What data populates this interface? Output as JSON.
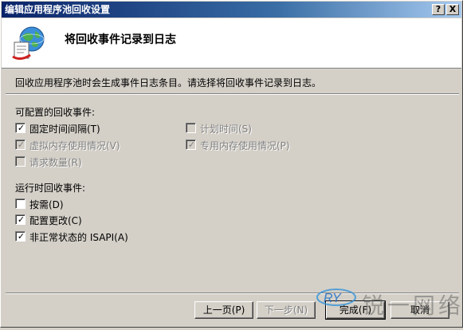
{
  "window": {
    "title": "编辑应用程序池回收设置",
    "help_button": "?",
    "close_button": "X"
  },
  "header": {
    "heading": "将回收事件记录到日志"
  },
  "description": "回收应用程序池时会生成事件日志条目。请选择将回收事件记录到日志。",
  "configurable": {
    "label": "可配置的回收事件:",
    "items": [
      {
        "label": "固定时间间隔(T)",
        "checked": true,
        "enabled": true
      },
      {
        "label": "计划时间(S)",
        "checked": false,
        "enabled": false
      },
      {
        "label": "虚拟内存使用情况(V)",
        "checked": true,
        "enabled": false
      },
      {
        "label": "专用内存使用情况(P)",
        "checked": true,
        "enabled": false
      },
      {
        "label": "请求数量(R)",
        "checked": false,
        "enabled": false
      }
    ]
  },
  "runtime": {
    "label": "运行时回收事件:",
    "items": [
      {
        "label": "按需(D)",
        "checked": false,
        "enabled": true
      },
      {
        "label": "配置更改(C)",
        "checked": true,
        "enabled": true
      },
      {
        "label": "非正常状态的 ISAPI(A)",
        "checked": true,
        "enabled": true
      }
    ]
  },
  "buttons": {
    "prev": "上一页(P)",
    "next": "下一步(N)",
    "finish": "完成(F)",
    "cancel": "取消"
  },
  "watermark": {
    "text": "锐一网络",
    "logo_text": "RY"
  },
  "colors": {
    "title_start": "#0a246a",
    "title_end": "#a6caf0",
    "face": "#d4d0c8"
  },
  "icons": {
    "header_logo": "globe-document-icon"
  }
}
